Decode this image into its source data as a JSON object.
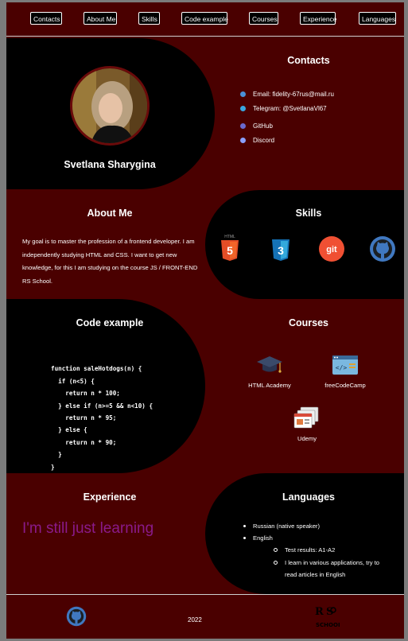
{
  "nav": {
    "items": [
      {
        "label": "Contacts",
        "key": "contacts"
      },
      {
        "label": "About Me",
        "key": "about"
      },
      {
        "label": "Skills",
        "key": "skills"
      },
      {
        "label": "Code example",
        "key": "code"
      },
      {
        "label": "Courses",
        "key": "courses"
      },
      {
        "label": "Experience",
        "key": "experience"
      },
      {
        "label": "Languages",
        "key": "languages"
      }
    ]
  },
  "profile": {
    "name": "Svetlana Sharygina"
  },
  "contacts": {
    "title": "Contacts",
    "items": [
      {
        "label": "Email: fidelity-67rus@mail.ru",
        "icon": "email-icon"
      },
      {
        "label": "Telegram: @SvetlanaVl67",
        "icon": "telegram-icon"
      },
      {
        "label": "GitHub",
        "icon": "github-icon"
      },
      {
        "label": "Discord",
        "icon": "discord-icon"
      }
    ]
  },
  "about": {
    "title": "About Me",
    "text": "My goal is to master the profession of a frontend developer. I am independently studying HTML and CSS. I want to get new knowledge, for this I am studying on the course JS / FRONT-END RS School."
  },
  "skills": {
    "title": "Skills",
    "items": [
      {
        "icon": "html5-icon",
        "text": "5",
        "caption": "HTML"
      },
      {
        "icon": "css3-icon",
        "text": "3"
      },
      {
        "icon": "git-icon",
        "text": "git"
      },
      {
        "icon": "github-icon"
      }
    ]
  },
  "code": {
    "title": "Code example",
    "lines": [
      "function saleHotdogs(n) {",
      "  if (n<5) {",
      "    return n * 100;",
      "  } else if (n>=5 && n<10) {",
      "    return n * 95;",
      "  } else {",
      "    return n * 90;",
      "  }",
      "}"
    ]
  },
  "courses": {
    "title": "Courses",
    "items": [
      {
        "label": "HTML Academy",
        "icon": "graduation-cap-icon"
      },
      {
        "label": "freeCodeCamp",
        "icon": "code-window-icon"
      },
      {
        "label": "Udemy",
        "icon": "browser-windows-icon"
      }
    ]
  },
  "experience": {
    "title": "Experience",
    "text": "I'm still just learning"
  },
  "languages": {
    "title": "Languages",
    "items": [
      "Russian (native speaker)",
      "English"
    ],
    "sub_items": [
      "Test results: A1-A2",
      "I learn in various applications, try to",
      "read articles in English"
    ]
  },
  "footer": {
    "year": "2022",
    "logo_text": "RS School"
  },
  "colors": {
    "background": "#4a0000",
    "blob": "#000000",
    "experience_text": "#8a1a8a"
  }
}
